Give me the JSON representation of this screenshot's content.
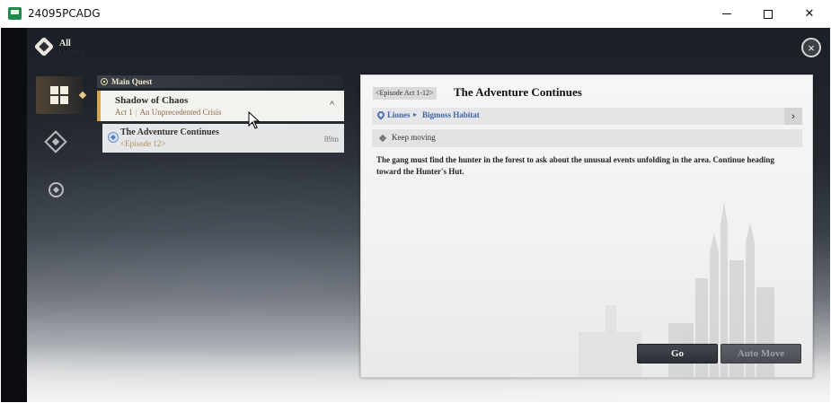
{
  "window": {
    "title": "24095PCADG",
    "minimize": "—",
    "maximize": "☐",
    "close": "✕"
  },
  "tab": {
    "label": "All"
  },
  "quest_list": {
    "header": "Main Quest",
    "group": {
      "title": "Shadow of Chaos",
      "act": "Act 1",
      "separator": "|",
      "subtitle": "An Unprecedented Crisis",
      "chevron": "^"
    },
    "item": {
      "title": "The Adventure Continues",
      "episode": "<Episode 12>",
      "time": "89m"
    }
  },
  "detail": {
    "episode_tag": "<Episode Act 1-12>",
    "title": "The Adventure Continues",
    "location_region": "Liones",
    "location_arrow": "▸",
    "location_area": "Bigmoss Habitat",
    "location_go": "›",
    "objective": "Keep moving",
    "description": "The gang must find the hunter in the forest to ask about the unusual events unfolding in the area. Continue heading toward the Hunter's Hut."
  },
  "buttons": {
    "go": "Go",
    "auto_move": "Auto Move"
  },
  "icons": {
    "close_game": "×"
  }
}
